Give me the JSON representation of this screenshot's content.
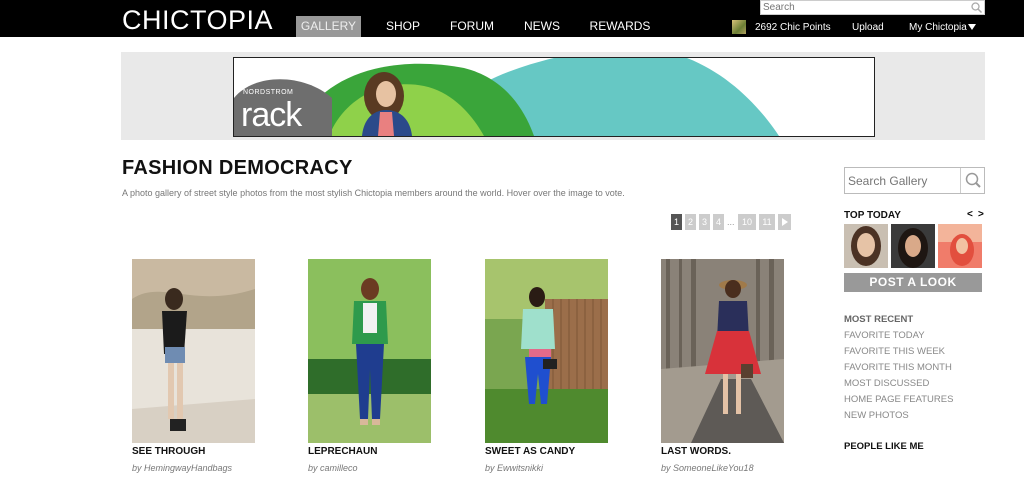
{
  "header": {
    "logo": "CHICTOPIA",
    "nav": [
      "GALLERY",
      "SHOP",
      "FORUM",
      "NEWS",
      "REWARDS"
    ],
    "search_placeholder": "Search",
    "points": "2692 Chic Points",
    "upload": "Upload",
    "my_chictopia": "My Chictopia"
  },
  "banner": {
    "brand_top": "NORDSTROM",
    "brand_main": "rack"
  },
  "main": {
    "title": "FASHION DEMOCRACY",
    "subtitle": "A photo gallery of street style photos from the most stylish Chictopia members around the world. Hover over the image to vote.",
    "pagination": {
      "current": "1",
      "pages": [
        "2",
        "3",
        "4"
      ],
      "ellipsis": "...",
      "tail": [
        "10",
        "11"
      ],
      "next_icon": "play-arrow-icon"
    },
    "photos": [
      {
        "caption": "SEE THROUGH",
        "by": "by HemingwayHandbags"
      },
      {
        "caption": "LEPRECHAUN",
        "by": "by camilleco"
      },
      {
        "caption": "SWEET AS CANDY",
        "by": "by Ewwitsnikki"
      },
      {
        "caption": "LAST WORDS.",
        "by": "by SomeoneLikeYou18"
      }
    ]
  },
  "sidebar": {
    "search_placeholder": "Search Gallery",
    "top_today": "TOP TODAY",
    "prev": "<",
    "next": ">",
    "post_button": "POST A LOOK",
    "links": [
      "MOST RECENT",
      "FAVORITE TODAY",
      "FAVORITE THIS WEEK",
      "FAVORITE THIS MONTH",
      "MOST DISCUSSED",
      "HOME PAGE FEATURES",
      "NEW PHOTOS"
    ],
    "people_like_me": "PEOPLE LIKE ME"
  },
  "colors": {
    "topbar": "#000000",
    "nav_active": "#999999",
    "pager_current": "#555555",
    "pager_other": "#cccccc",
    "ad_teal": "#66c8c4",
    "ad_green": "#3aa53a"
  }
}
